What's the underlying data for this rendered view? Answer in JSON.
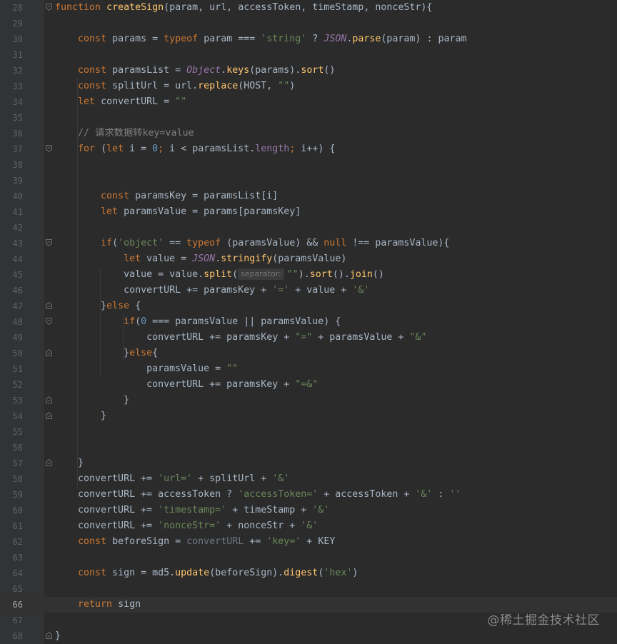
{
  "editor": {
    "current_line": 66,
    "watermark": "@稀土掘金技术社区"
  },
  "lines": [
    {
      "n": "28",
      "fold": "open",
      "tokens": [
        [
          "kw",
          "function "
        ],
        [
          "fn",
          "createSign"
        ],
        [
          "",
          "(param, url, accessToken, timeStamp, nonceStr){"
        ]
      ]
    },
    {
      "n": "29",
      "tokens": []
    },
    {
      "n": "30",
      "tokens": [
        [
          "",
          "    "
        ],
        [
          "kw",
          "const "
        ],
        [
          "",
          "params = "
        ],
        [
          "kw",
          "typeof "
        ],
        [
          "",
          "param === "
        ],
        [
          "str",
          "'string'"
        ],
        [
          "",
          " ? "
        ],
        [
          "glob",
          "JSON"
        ],
        [
          "",
          "."
        ],
        [
          "method",
          "parse"
        ],
        [
          "",
          "(param) : param"
        ]
      ]
    },
    {
      "n": "31",
      "tokens": []
    },
    {
      "n": "32",
      "tokens": [
        [
          "",
          "    "
        ],
        [
          "kw",
          "const "
        ],
        [
          "",
          "paramsList = "
        ],
        [
          "glob",
          "Object"
        ],
        [
          "",
          "."
        ],
        [
          "method",
          "keys"
        ],
        [
          "",
          "(params)."
        ],
        [
          "method",
          "sort"
        ],
        [
          "",
          "()"
        ]
      ]
    },
    {
      "n": "33",
      "tokens": [
        [
          "",
          "    "
        ],
        [
          "kw",
          "const "
        ],
        [
          "",
          "splitUrl = url."
        ],
        [
          "method",
          "replace"
        ],
        [
          "",
          "(HOST, "
        ],
        [
          "str",
          "\"\""
        ],
        [
          "",
          ")"
        ]
      ]
    },
    {
      "n": "34",
      "tokens": [
        [
          "",
          "    "
        ],
        [
          "kw",
          "let "
        ],
        [
          "",
          "convertURL = "
        ],
        [
          "str",
          "\"\""
        ]
      ]
    },
    {
      "n": "35",
      "tokens": []
    },
    {
      "n": "36",
      "tokens": [
        [
          "",
          "    "
        ],
        [
          "cmt",
          "// 请求数据转key=value"
        ]
      ]
    },
    {
      "n": "37",
      "fold": "open",
      "tokens": [
        [
          "",
          "    "
        ],
        [
          "kw",
          "for "
        ],
        [
          "",
          "("
        ],
        [
          "kw",
          "let "
        ],
        [
          "",
          "i = "
        ],
        [
          "num",
          "0"
        ],
        [
          "kw",
          "; "
        ],
        [
          "",
          "i < paramsList."
        ],
        [
          "prop",
          "length"
        ],
        [
          "kw",
          "; "
        ],
        [
          "",
          "i++) {"
        ]
      ]
    },
    {
      "n": "38",
      "tokens": []
    },
    {
      "n": "39",
      "tokens": []
    },
    {
      "n": "40",
      "tokens": [
        [
          "",
          "        "
        ],
        [
          "kw",
          "const "
        ],
        [
          "",
          "paramsKey = paramsList[i]"
        ]
      ]
    },
    {
      "n": "41",
      "tokens": [
        [
          "",
          "        "
        ],
        [
          "kw",
          "let "
        ],
        [
          "",
          "paramsValue = params[paramsKey]"
        ]
      ]
    },
    {
      "n": "42",
      "tokens": []
    },
    {
      "n": "43",
      "fold": "open",
      "tokens": [
        [
          "",
          "        "
        ],
        [
          "kw",
          "if"
        ],
        [
          "",
          "("
        ],
        [
          "str",
          "'object'"
        ],
        [
          "",
          " == "
        ],
        [
          "kw",
          "typeof "
        ],
        [
          "",
          "(paramsValue) && "
        ],
        [
          "kw",
          "null "
        ],
        [
          "",
          "!== paramsValue){"
        ]
      ]
    },
    {
      "n": "44",
      "tokens": [
        [
          "",
          "            "
        ],
        [
          "kw",
          "let "
        ],
        [
          "",
          "value = "
        ],
        [
          "glob",
          "JSON"
        ],
        [
          "",
          "."
        ],
        [
          "method",
          "stringify"
        ],
        [
          "",
          "(paramsValue)"
        ]
      ]
    },
    {
      "n": "45",
      "tokens": [
        [
          "",
          "            value = value."
        ],
        [
          "method",
          "split"
        ],
        [
          "",
          "("
        ],
        [
          "hint",
          "separator:"
        ],
        [
          "str",
          "\"\""
        ],
        [
          "",
          ")."
        ],
        [
          "method",
          "sort"
        ],
        [
          "",
          "()."
        ],
        [
          "method",
          "join"
        ],
        [
          "",
          "()"
        ]
      ]
    },
    {
      "n": "46",
      "tokens": [
        [
          "",
          "            convertURL += paramsKey + "
        ],
        [
          "str",
          "'='"
        ],
        [
          "",
          " + value + "
        ],
        [
          "str",
          "'&'"
        ]
      ]
    },
    {
      "n": "47",
      "fold": "close",
      "tokens": [
        [
          "",
          "        }"
        ],
        [
          "kw",
          "else "
        ],
        [
          "",
          "{"
        ]
      ]
    },
    {
      "n": "48",
      "fold": "open",
      "tokens": [
        [
          "",
          "            "
        ],
        [
          "kw",
          "if"
        ],
        [
          "",
          "("
        ],
        [
          "num",
          "0"
        ],
        [
          "",
          " === paramsValue || paramsValue) {"
        ]
      ]
    },
    {
      "n": "49",
      "tokens": [
        [
          "",
          "                convertURL += paramsKey + "
        ],
        [
          "str",
          "\"=\""
        ],
        [
          "",
          " + paramsValue + "
        ],
        [
          "str",
          "\"&\""
        ]
      ]
    },
    {
      "n": "50",
      "fold": "close",
      "tokens": [
        [
          "",
          "            }"
        ],
        [
          "kw",
          "else"
        ],
        [
          "",
          "{"
        ]
      ]
    },
    {
      "n": "51",
      "tokens": [
        [
          "",
          "                paramsValue = "
        ],
        [
          "str",
          "\"\""
        ]
      ]
    },
    {
      "n": "52",
      "tokens": [
        [
          "",
          "                convertURL += paramsKey + "
        ],
        [
          "str",
          "\"=&\""
        ]
      ]
    },
    {
      "n": "53",
      "fold": "close",
      "tokens": [
        [
          "",
          "            }"
        ]
      ]
    },
    {
      "n": "54",
      "fold": "close",
      "tokens": [
        [
          "",
          "        }"
        ]
      ]
    },
    {
      "n": "55",
      "tokens": []
    },
    {
      "n": "56",
      "tokens": []
    },
    {
      "n": "57",
      "fold": "close",
      "tokens": [
        [
          "",
          "    }"
        ]
      ]
    },
    {
      "n": "58",
      "tokens": [
        [
          "",
          "    convertURL += "
        ],
        [
          "str",
          "'url='"
        ],
        [
          "",
          " + splitUrl + "
        ],
        [
          "str",
          "'&'"
        ]
      ]
    },
    {
      "n": "59",
      "tokens": [
        [
          "",
          "    convertURL += accessToken ? "
        ],
        [
          "str",
          "'accessToken='"
        ],
        [
          "",
          " + accessToken + "
        ],
        [
          "str",
          "'&'"
        ],
        [
          "",
          " : "
        ],
        [
          "str",
          "''"
        ]
      ]
    },
    {
      "n": "60",
      "tokens": [
        [
          "",
          "    convertURL += "
        ],
        [
          "str",
          "'timestamp='"
        ],
        [
          "",
          " + timeStamp + "
        ],
        [
          "str",
          "'&'"
        ]
      ]
    },
    {
      "n": "61",
      "tokens": [
        [
          "",
          "    convertURL += "
        ],
        [
          "str",
          "'nonceStr='"
        ],
        [
          "",
          " + nonceStr + "
        ],
        [
          "str",
          "'&'"
        ]
      ]
    },
    {
      "n": "62",
      "tokens": [
        [
          "",
          "    "
        ],
        [
          "kw",
          "const "
        ],
        [
          "",
          "beforeSign = "
        ],
        [
          "faded",
          "convertURL"
        ],
        [
          "",
          " += "
        ],
        [
          "str",
          "'key='"
        ],
        [
          "",
          " + KEY"
        ]
      ]
    },
    {
      "n": "63",
      "tokens": []
    },
    {
      "n": "64",
      "tokens": [
        [
          "",
          "    "
        ],
        [
          "kw",
          "const "
        ],
        [
          "",
          "sign = md5."
        ],
        [
          "method",
          "update"
        ],
        [
          "",
          "(beforeSign)."
        ],
        [
          "method",
          "digest"
        ],
        [
          "",
          "("
        ],
        [
          "str",
          "'hex'"
        ],
        [
          "",
          ")"
        ]
      ]
    },
    {
      "n": "65",
      "tokens": []
    },
    {
      "n": "66",
      "tokens": [
        [
          "",
          "    "
        ],
        [
          "kw",
          "return "
        ],
        [
          "",
          "sign"
        ]
      ]
    },
    {
      "n": "67",
      "tokens": []
    },
    {
      "n": "68",
      "fold": "close",
      "tokens": [
        [
          "",
          "}"
        ]
      ]
    }
  ]
}
